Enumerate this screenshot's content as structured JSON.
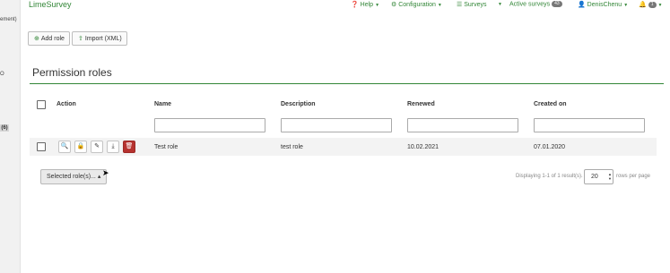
{
  "left_strip": {
    "text1": "ement)",
    "text2": "O",
    "badge": "(6)"
  },
  "topbar": {
    "brand": "LimeSurvey",
    "help": "Help",
    "configuration": "Configuration",
    "surveys": "Surveys",
    "active_surveys": "Active surveys",
    "active_surveys_count": "43",
    "user": "DenisChenu",
    "notifications_count": "1"
  },
  "toolbar": {
    "add_role": "Add role",
    "import_xml": "Import (XML)"
  },
  "page": {
    "title": "Permission roles"
  },
  "table": {
    "headers": {
      "action": "Action",
      "name": "Name",
      "description": "Description",
      "renewed": "Renewed",
      "created_on": "Created on"
    },
    "rows": [
      {
        "name": "Test role",
        "description": "test role",
        "renewed": "10.02.2021",
        "created_on": "07.01.2020"
      }
    ]
  },
  "footer": {
    "selected_roles": "Selected role(s)...",
    "displaying": "Displaying 1-1 of 1 result(s).",
    "page_size": "20",
    "rows_per_page": "rows per page"
  },
  "colors": {
    "brand": "#328637",
    "danger": "#b6322f",
    "rule": "#328637"
  }
}
